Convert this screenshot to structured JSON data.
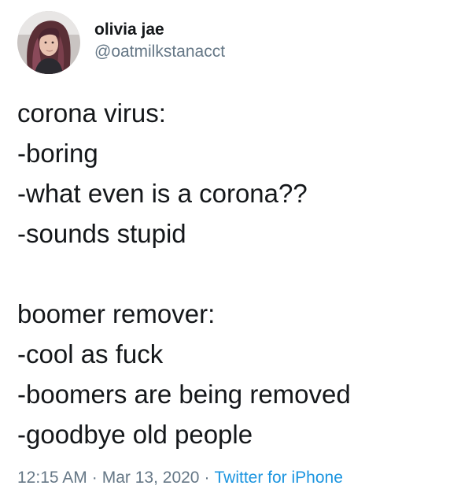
{
  "user": {
    "display_name": "olivia jae",
    "handle": "@oatmilkstanacct"
  },
  "tweet": {
    "lines": [
      "corona virus:",
      "-boring",
      "-what even is a corona??",
      "-sounds stupid",
      "",
      "boomer remover:",
      "-cool as fuck",
      "-boomers are being removed",
      "-goodbye old people"
    ],
    "time": "12:15 AM",
    "date": "Mar 13, 2020",
    "separator": "·",
    "source": "Twitter for iPhone"
  },
  "colors": {
    "text": "#14171a",
    "secondary": "#657786",
    "link": "#1b95e0"
  },
  "icons": {
    "avatar": "profile-photo"
  }
}
